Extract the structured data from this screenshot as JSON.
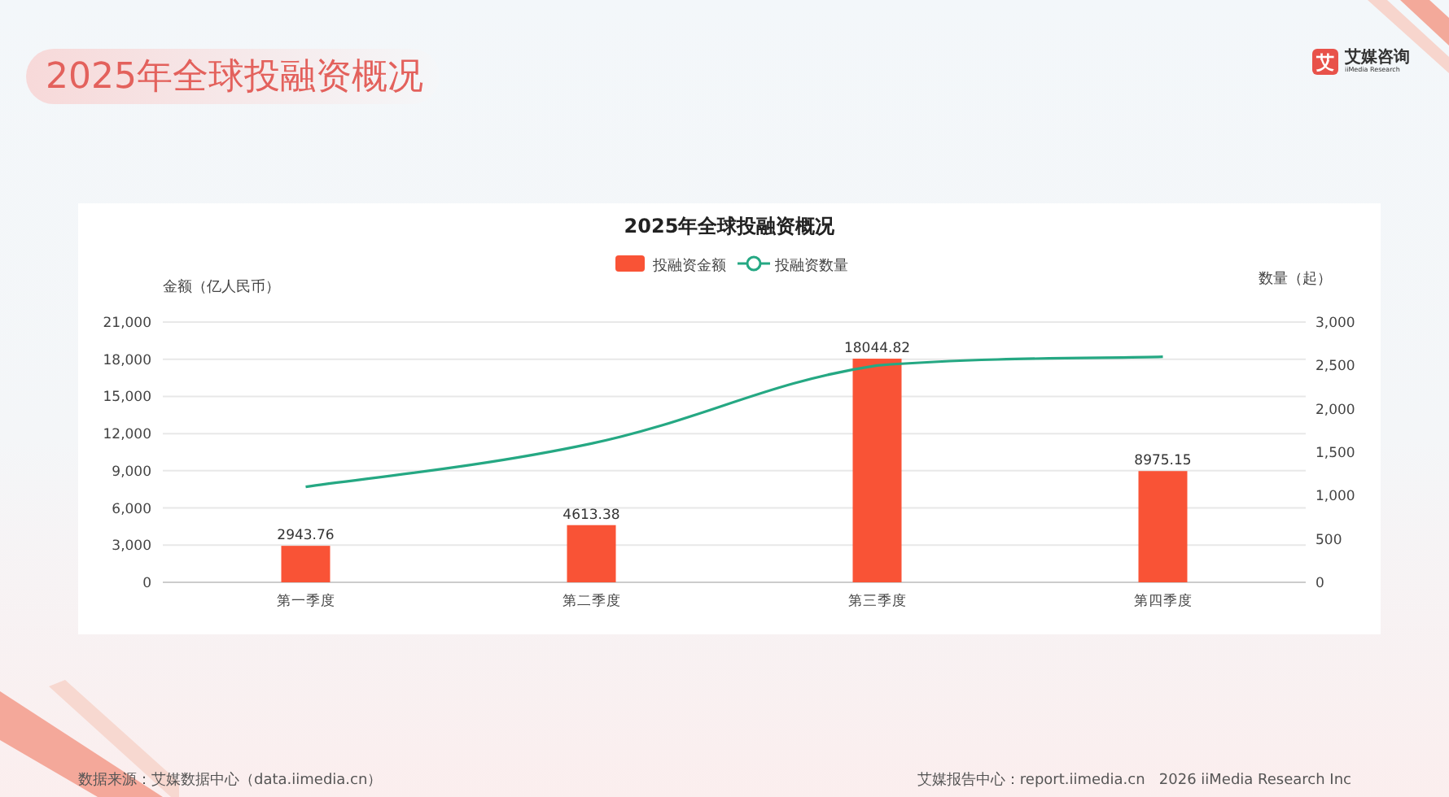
{
  "header": {
    "title": "2025年全球投融资概况",
    "logo": {
      "mark": "艾",
      "name": "艾媒咨询",
      "sub": "iiMedia Research"
    }
  },
  "chart": {
    "chart_data": {
      "type": "bar",
      "title": "2025年全球投融资概况",
      "legend": "top",
      "grid": "y",
      "categories": [
        "第一季度",
        "第二季度",
        "第三季度",
        "第四季度"
      ],
      "series": [
        {
          "name": "投融资金额",
          "color": "#f95336",
          "values": [
            2943.76,
            4613.38,
            18044.82,
            8975.15
          ]
        },
        {
          "name": "投融资数量",
          "color": "#25a883",
          "type": "line",
          "axis": "y2",
          "values": [
            1100,
            1600,
            2500,
            2600
          ]
        }
      ],
      "ylabel": "金额（亿人民币）",
      "y2label": "数量（起）",
      "ylim": [
        0,
        21000
      ],
      "yticks": [
        {
          "value": 0,
          "label": "0"
        },
        {
          "value": 3000,
          "label": "3,000"
        },
        {
          "value": 6000,
          "label": "6,000"
        },
        {
          "value": 9000,
          "label": "9,000"
        },
        {
          "value": 12000,
          "label": "12,000"
        },
        {
          "value": 15000,
          "label": "15,000"
        },
        {
          "value": 18000,
          "label": "18,000"
        },
        {
          "value": 21000,
          "label": "21,000"
        }
      ],
      "y2lim": [
        0,
        3000
      ],
      "y2ticks": [
        {
          "value": 0,
          "label": "0"
        },
        {
          "value": 500,
          "label": "500"
        },
        {
          "value": 1000,
          "label": "1,000"
        },
        {
          "value": 1500,
          "label": "1,500"
        },
        {
          "value": 2000,
          "label": "2,000"
        },
        {
          "value": 2500,
          "label": "2,500"
        },
        {
          "value": 3000,
          "label": "3,000"
        }
      ],
      "value_labels": [
        "2943.76",
        "4613.38",
        "18044.82",
        "8975.15"
      ]
    }
  },
  "footer": {
    "source": "数据来源：艾媒数据中心（data.iimedia.cn）",
    "report": "艾媒报告中心：report.iimedia.cn   2026 iiMedia Research Inc"
  }
}
